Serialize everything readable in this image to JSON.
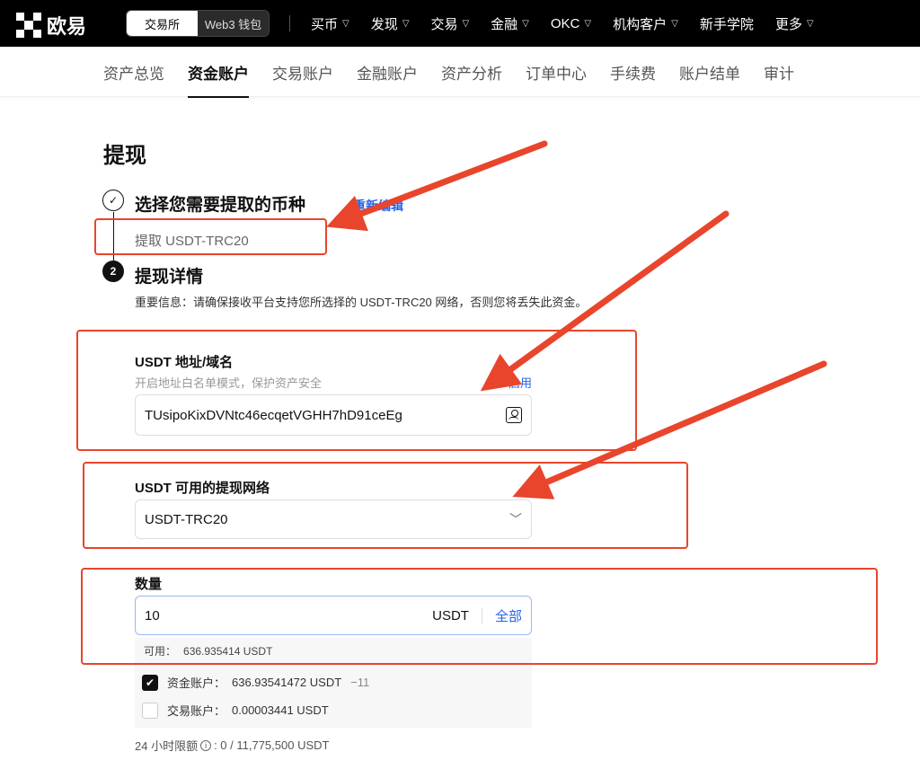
{
  "topbar": {
    "brand": "欧易",
    "switcher": [
      "交易所",
      "Web3 钱包"
    ],
    "nav": [
      {
        "label": "买币",
        "dropdown": true
      },
      {
        "label": "发现",
        "dropdown": true
      },
      {
        "label": "交易",
        "dropdown": true
      },
      {
        "label": "金融",
        "dropdown": true
      },
      {
        "label": "OKC",
        "dropdown": true
      },
      {
        "label": "机构客户",
        "dropdown": true
      },
      {
        "label": "新手学院",
        "dropdown": false
      },
      {
        "label": "更多",
        "dropdown": true
      }
    ]
  },
  "subnav": {
    "items": [
      "资产总览",
      "资金账户",
      "交易账户",
      "金融账户",
      "资产分析",
      "订单中心",
      "手续费",
      "账户结单",
      "审计"
    ],
    "active": "资金账户"
  },
  "page": {
    "title": "提现",
    "step1": {
      "num": "✓",
      "title": "选择您需要提取的币种",
      "edit": "重新编辑",
      "selected": "提取 USDT-TRC20"
    },
    "step2": {
      "num": "2",
      "title": "提现详情",
      "notice": "重要信息：请确保接收平台支持您所选择的 USDT-TRC20 网络，否则您将丢失此资金。"
    },
    "address": {
      "label": "USDT 地址/域名",
      "hint": "开启地址白名单模式，保护资产安全",
      "enable": "启用",
      "value": "TUsipoKixDVNtc46ecqetVGHH7hD91ceEg"
    },
    "network": {
      "label": "USDT 可用的提现网络",
      "value": "USDT-TRC20"
    },
    "amount": {
      "label": "数量",
      "value": "10",
      "unit": "USDT",
      "all": "全部"
    },
    "available": {
      "label": "可用：",
      "value": "636.935414 USDT"
    },
    "accounts": [
      {
        "name": "资金账户：",
        "value": "636.93541472 USDT",
        "delta": "−11",
        "checked": true
      },
      {
        "name": "交易账户：",
        "value": "0.00003441 USDT",
        "delta": "",
        "checked": false
      }
    ],
    "limit": {
      "label": "24 小时限额",
      "value": ": 0 / 11,775,500 USDT"
    }
  },
  "colors": {
    "accent": "#2563eb",
    "annotation": "#e8452c",
    "topbar": "#000000"
  }
}
